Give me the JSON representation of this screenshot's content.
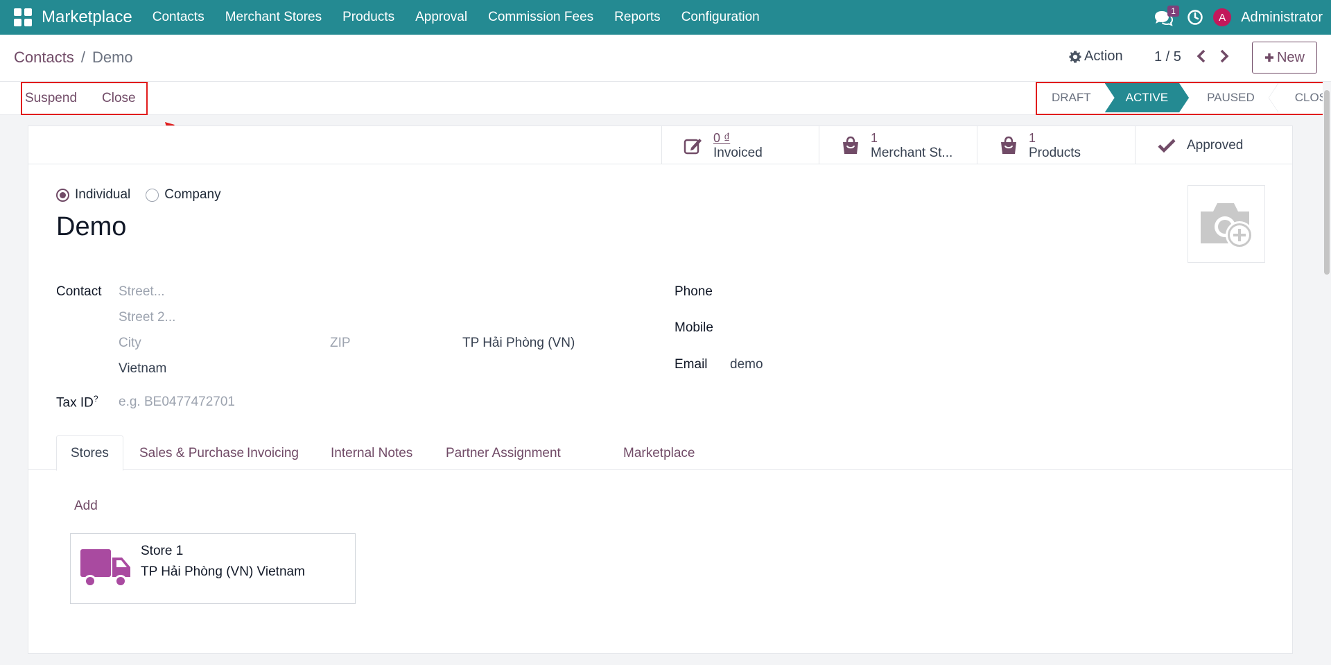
{
  "navbar": {
    "brand": "Marketplace",
    "menu": [
      "Contacts",
      "Merchant Stores",
      "Products",
      "Approval",
      "Commission Fees",
      "Reports",
      "Configuration"
    ],
    "chat_count": "1",
    "avatar_letter": "A",
    "user": "Administrator",
    "color": "#248a92"
  },
  "control": {
    "breadcrumb_parent": "Contacts",
    "breadcrumb_sep": "/",
    "breadcrumb_current": "Demo",
    "action_label": "Action",
    "pager": "1 / 5",
    "new_label": "New"
  },
  "statusbar": {
    "buttons": [
      "Suspend",
      "Close"
    ],
    "stages": [
      "DRAFT",
      "ACTIVE",
      "PAUSED",
      "CLOSED"
    ],
    "active_stage": "ACTIVE",
    "highlight_color": "#e11d1d"
  },
  "smart_buttons": {
    "invoiced_value": "0 ₫",
    "invoiced_label": "Invoiced",
    "stores_value": "1",
    "stores_label": "Merchant St...",
    "products_value": "1",
    "products_label": "Products",
    "approved_label": "Approved"
  },
  "form": {
    "type_options": [
      "Individual",
      "Company"
    ],
    "type_selected": "Individual",
    "name": "Demo",
    "contact_label": "Contact",
    "street_ph": "Street...",
    "street2_ph": "Street 2...",
    "city_ph": "City",
    "zip_ph": "ZIP",
    "state": "TP Hải Phòng (VN)",
    "country": "Vietnam",
    "tax_label": "Tax ID",
    "tax_help": "?",
    "tax_ph": "e.g. BE0477472701",
    "phone_label": "Phone",
    "mobile_label": "Mobile",
    "email_label": "Email",
    "email_value": "demo"
  },
  "tabs": [
    "Stores",
    "Sales & Purchase",
    "Invoicing",
    "Internal Notes",
    "Partner Assignment",
    "Marketplace"
  ],
  "stores": {
    "add_label": "Add",
    "items": [
      {
        "name": "Store 1",
        "address": "TP Hải Phòng (VN) Vietnam"
      }
    ]
  },
  "accent_color": "#714b67"
}
